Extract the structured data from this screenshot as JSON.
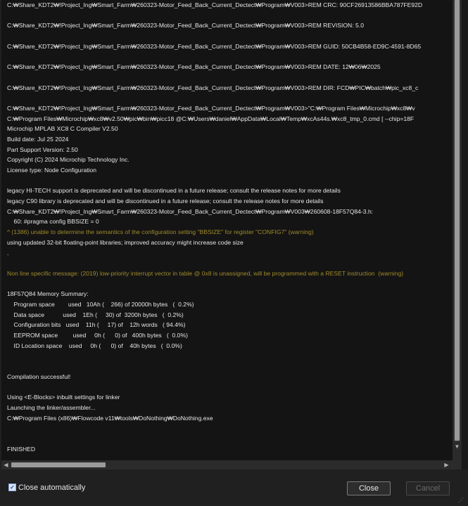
{
  "console": {
    "lines": [
      {
        "text": "C:₩Share_KDT2₩!Project_Ing₩Smart_Farm₩260323-Motor_Feed_Back_Current_Dectect₩Program₩V003>REM CRC: 90CF26913586BBA787FE92D",
        "style": "normal"
      },
      {
        "text": "",
        "style": "normal"
      },
      {
        "text": "C:₩Share_KDT2₩!Project_Ing₩Smart_Farm₩260323-Motor_Feed_Back_Current_Dectect₩Program₩V003>REM REVISION: 5.0",
        "style": "normal"
      },
      {
        "text": "",
        "style": "normal"
      },
      {
        "text": "C:₩Share_KDT2₩!Project_Ing₩Smart_Farm₩260323-Motor_Feed_Back_Current_Dectect₩Program₩V003>REM GUID: 50CB4B58-ED9C-4591-8D65",
        "style": "normal"
      },
      {
        "text": "",
        "style": "normal"
      },
      {
        "text": "C:₩Share_KDT2₩!Project_Ing₩Smart_Farm₩260323-Motor_Feed_Back_Current_Dectect₩Program₩V003>REM DATE: 12₩06₩2025",
        "style": "normal"
      },
      {
        "text": "",
        "style": "normal"
      },
      {
        "text": "C:₩Share_KDT2₩!Project_Ing₩Smart_Farm₩260323-Motor_Feed_Back_Current_Dectect₩Program₩V003>REM DIR: FCD₩PIC₩batch₩pic_xc8_c",
        "style": "normal"
      },
      {
        "text": "",
        "style": "normal"
      },
      {
        "text": "C:₩Share_KDT2₩!Project_Ing₩Smart_Farm₩260323-Motor_Feed_Back_Current_Dectect₩Program₩V003>\"C:₩Program Files₩Microchip₩xc8₩v",
        "style": "normal"
      },
      {
        "text": "C:₩Program Files₩Microchip₩xc8₩v2.50₩pic₩bin₩picc18 @C:₩Users₩daniel₩AppData₩Local₩Temp₩xcAs44s.₩xc8_tmp_0.cmd [ --chip=18F",
        "style": "normal"
      },
      {
        "text": "Microchip MPLAB XC8 C Compiler V2.50",
        "style": "normal"
      },
      {
        "text": "Build date: Jul 25 2024",
        "style": "normal"
      },
      {
        "text": "Part Support Version: 2.50",
        "style": "normal"
      },
      {
        "text": "Copyright (C) 2024 Microchip Technology Inc.",
        "style": "normal"
      },
      {
        "text": "License type: Node Configuration",
        "style": "normal"
      },
      {
        "text": "",
        "style": "normal"
      },
      {
        "text": "legacy HI-TECH support is deprecated and will be discontinued in a future release; consult the release notes for more details",
        "style": "normal"
      },
      {
        "text": "legacy C90 library is deprecated and will be discontinued in a future release; consult the release notes for more details",
        "style": "normal"
      },
      {
        "text": "C:₩Share_KDT2₩!Project_Ing₩Smart_Farm₩260323-Motor_Feed_Back_Current_Dectect₩Program₩V003₩260608-18F57Q84-3.h:",
        "style": "normal"
      },
      {
        "text": "    60: #pragma config BBSIZE = 0",
        "style": "normal"
      },
      {
        "text": "^ (1386) unable to determine the semantics of the configuration setting \"BBSIZE\" for register \"CONFIG7\" (warning)",
        "style": "warn"
      },
      {
        "text": "using updated 32-bit floating-point libraries; improved accuracy might increase code size",
        "style": "normal"
      },
      {
        "text": ".",
        "style": "normal"
      },
      {
        "text": "",
        "style": "normal"
      },
      {
        "text": "Non line specific message: (2019) low-priority interrupt vector in table @ 0x8 is unassigned, will be programmed with a RESET instruction  (warning)",
        "style": "warn"
      },
      {
        "text": "",
        "style": "normal"
      },
      {
        "text": "18F57Q84 Memory Summary:",
        "style": "normal"
      },
      {
        "text": "    Program space        used   10Ah (    266) of 20000h bytes   (  0.2%)",
        "style": "normal"
      },
      {
        "text": "    Data space           used    1Eh (     30) of  3200h bytes   (  0.2%)",
        "style": "normal"
      },
      {
        "text": "    Configuration bits   used    11h (     17) of    12h words   ( 94.4%)",
        "style": "normal"
      },
      {
        "text": "    EEPROM space         used     0h (      0) of   400h bytes   (  0.0%)",
        "style": "normal"
      },
      {
        "text": "    ID Location space    used     0h (      0) of    40h bytes   (  0.0%)",
        "style": "normal"
      },
      {
        "text": "",
        "style": "normal"
      },
      {
        "text": "",
        "style": "normal"
      },
      {
        "text": "Compilation successful!",
        "style": "normal"
      },
      {
        "text": "",
        "style": "normal"
      },
      {
        "text": "Using <E-Blocks> inbuilt settings for linker",
        "style": "normal"
      },
      {
        "text": "Launching the linker/assembler...",
        "style": "normal"
      },
      {
        "text": "C:₩Program Files (x86)₩Flowcode v11₩tools₩DoNothing₩DoNothing.exe",
        "style": "normal"
      },
      {
        "text": "",
        "style": "normal"
      },
      {
        "text": "",
        "style": "normal"
      },
      {
        "text": "FINISHED",
        "style": "normal"
      }
    ]
  },
  "footer": {
    "close_auto_label": "Close automatically",
    "close_auto_checked": true,
    "close_button": "Close",
    "cancel_button": "Cancel"
  },
  "icons": {
    "checkbox": "checkmark-icon",
    "scroll_up": "arrow-up-icon",
    "scroll_down": "arrow-down-icon",
    "scroll_left": "arrow-left-icon",
    "scroll_right": "arrow-right-icon",
    "resize": "resize-grip-icon"
  },
  "colors": {
    "console_bg": "#141414",
    "console_text": "#e6e6e6",
    "warning_text": "#a08a2a"
  }
}
